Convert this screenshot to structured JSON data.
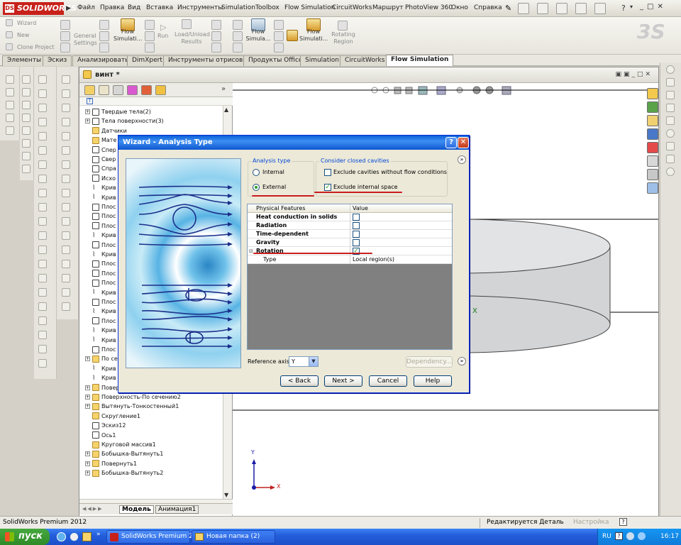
{
  "app": {
    "logo": "SOLIDWORKS",
    "menu": [
      "Файл",
      "Правка",
      "Вид",
      "Вставка",
      "Инструменты",
      "Simulation",
      "Toolbox",
      "Flow Simulation",
      "CircuitWorks",
      "Маршрут",
      "PhotoView 360",
      "Окно",
      "Справка"
    ]
  },
  "command_manager": {
    "items": [
      "Wizard",
      "New",
      "Clone Project",
      "General Settings",
      "Flow Simulati...",
      "Run",
      "Load/Unload Results",
      "Flow Simula...",
      "Flow Simulati...",
      "Rotating Region"
    ]
  },
  "tabs": {
    "items": [
      "Элементы",
      "Эскиз",
      "Анализировать",
      "DimXpert",
      "Инструменты отрисовки",
      "Продукты Office",
      "Simulation",
      "CircuitWorks",
      "Flow Simulation"
    ],
    "active": "Flow Simulation"
  },
  "document": {
    "title": "винт *"
  },
  "feature_tree": {
    "items": [
      {
        "label": "Твердые тела(2)",
        "expand": "+"
      },
      {
        "label": "Тела поверхности(3)",
        "expand": "+"
      },
      {
        "label": "Датчики",
        "expand": ""
      },
      {
        "label": "Мате",
        "expand": ""
      },
      {
        "label": "Спер",
        "expand": ""
      },
      {
        "label": "Свер",
        "expand": ""
      },
      {
        "label": "Спра",
        "expand": ""
      },
      {
        "label": "Исхо",
        "expand": ""
      },
      {
        "label": "Крив",
        "expand": ""
      },
      {
        "label": "Крив",
        "expand": ""
      },
      {
        "label": "Плос",
        "expand": ""
      },
      {
        "label": "Плос",
        "expand": ""
      },
      {
        "label": "Плос",
        "expand": ""
      },
      {
        "label": "Крив",
        "expand": ""
      },
      {
        "label": "Плос",
        "expand": ""
      },
      {
        "label": "Крив",
        "expand": ""
      },
      {
        "label": "Плос",
        "expand": ""
      },
      {
        "label": "Плос",
        "expand": ""
      },
      {
        "label": "Плос",
        "expand": ""
      },
      {
        "label": "Крив",
        "expand": ""
      },
      {
        "label": "Плос",
        "expand": ""
      },
      {
        "label": "Крив",
        "expand": ""
      },
      {
        "label": "Плос",
        "expand": ""
      },
      {
        "label": "Крив",
        "expand": ""
      },
      {
        "label": "Крив",
        "expand": ""
      },
      {
        "label": "Плос",
        "expand": ""
      },
      {
        "label": "По се",
        "expand": "+"
      },
      {
        "label": "Крив",
        "expand": ""
      },
      {
        "label": "Крив",
        "expand": ""
      },
      {
        "label": "Поверхность-По сечению1",
        "expand": "+"
      },
      {
        "label": "Поверхность-По сечению2",
        "expand": "+"
      },
      {
        "label": "Вытянуть-Тонкостенный1",
        "expand": "+"
      },
      {
        "label": "Скругление1",
        "expand": ""
      },
      {
        "label": "Эскиз12",
        "expand": ""
      },
      {
        "label": "Ось1",
        "expand": ""
      },
      {
        "label": "Круговой массив1",
        "expand": ""
      },
      {
        "label": "Бобышка-Вытянуть1",
        "expand": "+"
      },
      {
        "label": "Повернуть1",
        "expand": "+"
      },
      {
        "label": "Бобышка-Вытянуть2",
        "expand": "+"
      }
    ],
    "bottom_tabs": [
      "Модель",
      "Анимация1"
    ]
  },
  "dialog": {
    "title": "Wizard - Analysis Type",
    "help_button": "?",
    "close_button": "✕",
    "analysis_type": {
      "legend": "Analysis type",
      "options": [
        {
          "label": "Internal",
          "selected": false
        },
        {
          "label": "External",
          "selected": true
        }
      ]
    },
    "closed_cavities": {
      "legend": "Consider closed cavities",
      "options": [
        {
          "label": "Exclude cavities without flow conditions",
          "checked": false
        },
        {
          "label": "Exclude internal space",
          "checked": true
        }
      ]
    },
    "table": {
      "headers": [
        "Physical Features",
        "Value"
      ],
      "rows": [
        {
          "label": "Heat conduction in solids",
          "checked": false
        },
        {
          "label": "Radiation",
          "checked": false
        },
        {
          "label": "Time-dependent",
          "checked": false
        },
        {
          "label": "Gravity",
          "checked": false
        },
        {
          "label": "Rotation",
          "checked": true
        },
        {
          "label": "Type",
          "value": "Local region(s)"
        }
      ]
    },
    "reference_axis": {
      "label": "Reference axis:",
      "value": "Y"
    },
    "dependency_button": "Dependency...",
    "buttons": {
      "back": "< Back",
      "next": "Next >",
      "cancel": "Cancel",
      "help": "Help"
    }
  },
  "triad": {
    "y": "Y",
    "x": "X"
  },
  "graphics_axis_label": "X",
  "status_bar": {
    "left": "SolidWorks Premium 2012",
    "middle": "Редактируется Деталь",
    "right": "Настройка"
  },
  "taskbar": {
    "start": "пуск",
    "tasks": [
      "SolidWorks Premium 2...",
      "Новая папка (2)"
    ],
    "lang": "RU",
    "clock": "16:17"
  },
  "colors": {
    "annotation_red": "#c81e1e",
    "dialog_title": "#0a5fd8",
    "cylinder_fill": "#d2d4d6",
    "accent_blue": "#0046d5"
  }
}
